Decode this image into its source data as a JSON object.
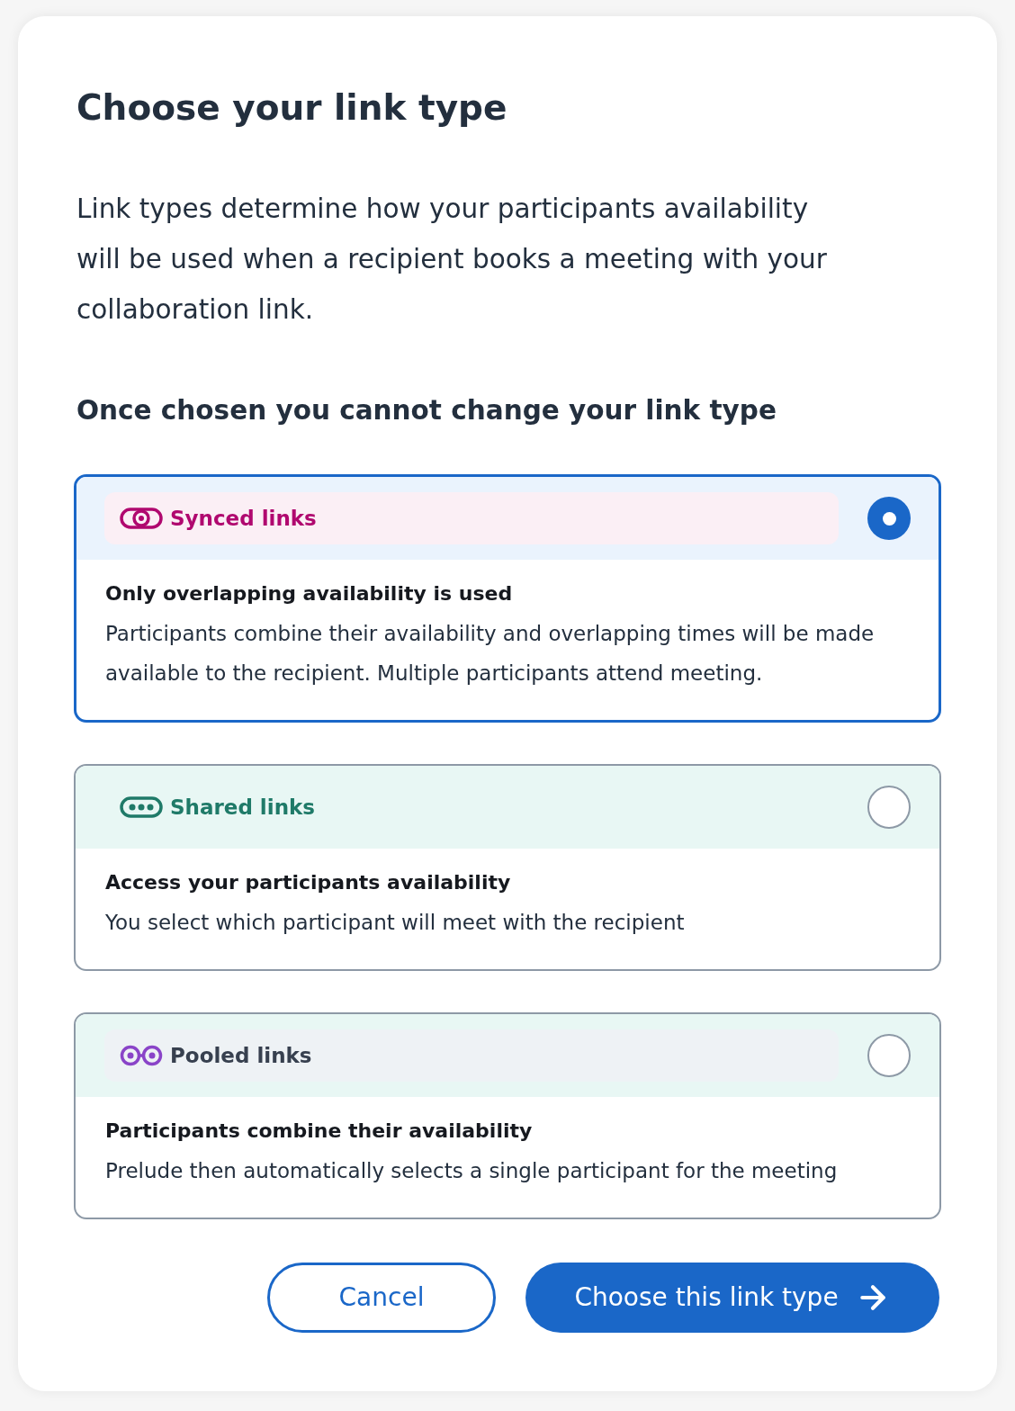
{
  "title": "Choose your link type",
  "description": "Link types determine how your participants availability will be used when a recipient books a meeting with your collaboration link.",
  "warning": "Once chosen you cannot change your link type",
  "options": [
    {
      "kind": "synced",
      "color": "#b0086f",
      "label": {
        "text": "Synced links",
        "color": "#b0086f"
      },
      "heading": "Only overlapping availability is used",
      "description": "Participants combine their availability and overlapping times will be made available to the recipient. Multiple participants attend meeting.",
      "selected": true
    },
    {
      "kind": "shared",
      "color": "#1f7a68",
      "label": {
        "text": "Shared links",
        "color": "#1f7a68"
      },
      "heading": "Access your participants availability",
      "description": "You select which participant will meet with the recipient",
      "selected": false
    },
    {
      "kind": "pooled",
      "color": "#8a44c8",
      "label": {
        "text": "Pooled links",
        "color": "#37404f"
      },
      "heading": "Participants combine their availability",
      "description": "Prelude then automatically selects a single participant for the meeting",
      "selected": false
    }
  ],
  "buttons": {
    "cancel": "Cancel",
    "confirm": "Choose this link type"
  }
}
